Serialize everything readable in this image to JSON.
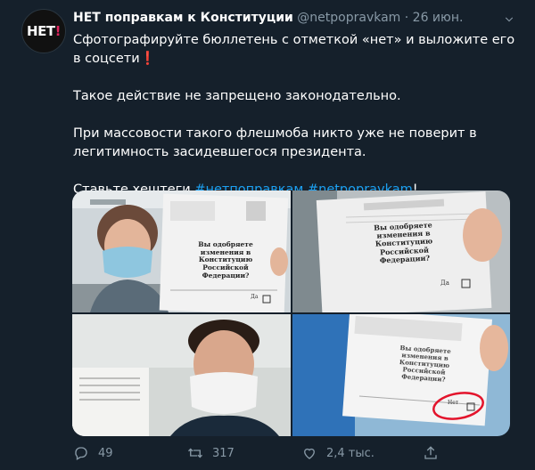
{
  "tweet": {
    "avatar_text": "НЕТ!",
    "author_name": "НЕТ поправкам к Конституции",
    "handle": "@netpopravkam",
    "separator": "·",
    "date": "26 июн.",
    "more_icon": "more-icon",
    "text_line1": "Сфотографируйте бюллетень с отметкой «нет» и выложите его в соцсети",
    "text_line1_mark": "❗",
    "text_line2": "Такое действие не запрещено законодательно.",
    "text_line3": "При массовости такого флешмоба никто уже не поверит в легитимность засидевшегося президента.",
    "text_line4_prefix": "Ставьте хештеги ",
    "hashtag1": "#нетпоправкам",
    "hashtag2": "#netpopravkam",
    "text_line4_suffix": "!"
  },
  "ballot": {
    "question": "Вы одобряете изменения в Конституцию Российской Федерации?",
    "yes_label": "Да",
    "no_label": "Нет"
  },
  "actions": {
    "reply_count": "49",
    "retweet_count": "317",
    "like_count": "2,4 тыс."
  },
  "colors": {
    "background": "#15202b",
    "secondary_text": "#8899a6",
    "link": "#1da1f2",
    "accent_red": "#e0245e"
  }
}
